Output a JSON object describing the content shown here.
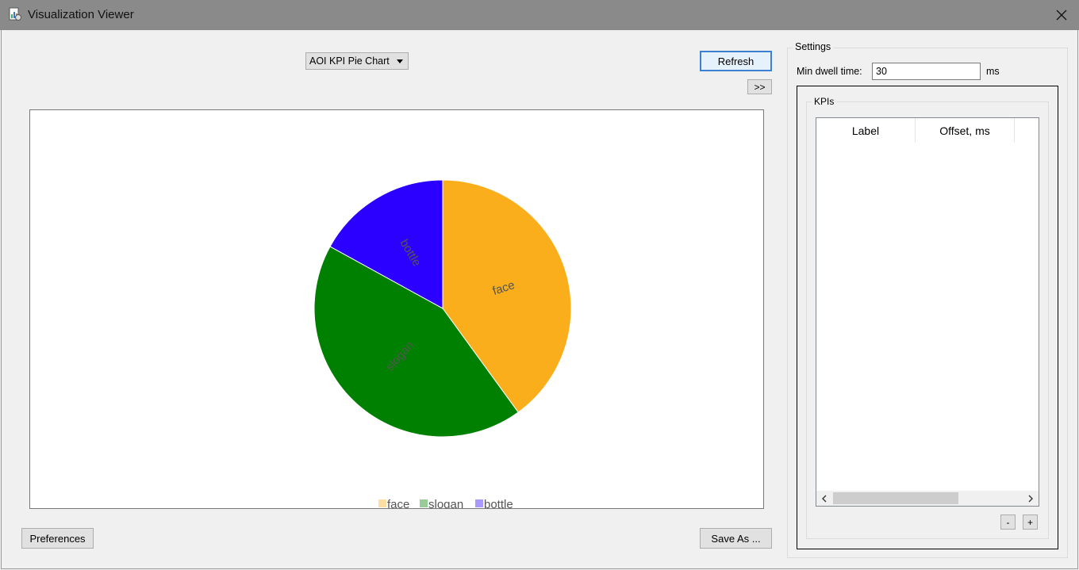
{
  "window": {
    "title": "Visualization Viewer",
    "close_icon": "close-icon",
    "app_icon": "app-icon"
  },
  "toolbar": {
    "chart_type_select": "AOI KPI Pie Chart",
    "refresh_label": "Refresh",
    "expand_label": ">>"
  },
  "footer": {
    "preferences_label": "Preferences",
    "save_as_label": "Save As ..."
  },
  "settings": {
    "title": "Settings",
    "min_dwell_label": "Min dwell time:",
    "min_dwell_value": "30",
    "min_dwell_unit": "ms",
    "kpis": {
      "title": "KPIs",
      "columns": [
        "Label",
        "Offset, ms"
      ],
      "rows": [],
      "remove_label": "-",
      "add_label": "+"
    }
  },
  "chart_data": {
    "type": "pie",
    "title": "",
    "slices": [
      {
        "label": "face",
        "value": 40,
        "color": "#FBAE1C"
      },
      {
        "label": "slogan",
        "value": 43,
        "color": "#008000"
      },
      {
        "label": "bottle",
        "value": 17,
        "color": "#2B00FF"
      }
    ],
    "legend": {
      "position": "bottom",
      "entries": [
        "face",
        "slogan",
        "bottle"
      ]
    },
    "label_color": "#555555"
  }
}
